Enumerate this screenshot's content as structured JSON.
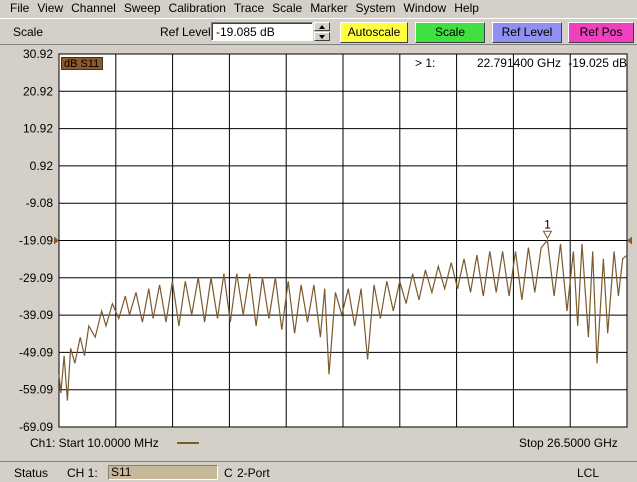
{
  "menu": [
    "File",
    "View",
    "Channel",
    "Sweep",
    "Calibration",
    "Trace",
    "Scale",
    "Marker",
    "System",
    "Window",
    "Help"
  ],
  "toolbar": {
    "scale_label": "Scale",
    "ref_level_label": "Ref Level",
    "ref_level_value": "-19.085 dB",
    "autoscale_label": "Autoscale",
    "scale_button_label": "Scale",
    "ref_level_button_label": "Ref Level",
    "ref_pos_button_label": "Ref Pos",
    "colors": {
      "autoscale": "#ffff40",
      "scale": "#40e040",
      "ref_level": "#9090f0",
      "ref_pos": "#f040c0"
    }
  },
  "plot": {
    "trace_badge": "dB S11",
    "marker": {
      "label": "> 1:",
      "freq": "22.791400 GHz",
      "value": "-19.025 dB",
      "number": "1"
    },
    "start": "Ch1: Start  10.0000 MHz",
    "stop": "Stop  26.5000 GHz",
    "trace_color": "#7b5a2e",
    "grid_color": "#000000",
    "background": "#ffffff"
  },
  "chart_data": {
    "type": "line",
    "ylabel": "dB",
    "yticks": [
      "30.92",
      "20.92",
      "10.92",
      "0.92",
      "-9.08",
      "-19.09",
      "-29.09",
      "-39.09",
      "-49.09",
      "-59.09",
      "-69.09"
    ],
    "ylim": [
      -69.09,
      30.92
    ],
    "xlim": [
      0.01,
      26.5
    ],
    "x_unit": "GHz",
    "reference_level": -19.085,
    "grid": true,
    "series": [
      {
        "values": [
          [
            0.01,
            -55
          ],
          [
            0.1,
            -60
          ],
          [
            0.25,
            -50
          ],
          [
            0.4,
            -62
          ],
          [
            0.55,
            -48
          ],
          [
            0.75,
            -52
          ],
          [
            1.0,
            -45
          ],
          [
            1.2,
            -50
          ],
          [
            1.4,
            -42
          ],
          [
            1.7,
            -45
          ],
          [
            2.0,
            -38
          ],
          [
            2.2,
            -42
          ],
          [
            2.5,
            -36
          ],
          [
            2.8,
            -40
          ],
          [
            3.1,
            -34
          ],
          [
            3.3,
            -39
          ],
          [
            3.6,
            -33
          ],
          [
            3.9,
            -41
          ],
          [
            4.2,
            -32
          ],
          [
            4.4,
            -40
          ],
          [
            4.7,
            -31
          ],
          [
            5.0,
            -41
          ],
          [
            5.3,
            -30
          ],
          [
            5.6,
            -42
          ],
          [
            5.9,
            -30
          ],
          [
            6.2,
            -39
          ],
          [
            6.5,
            -29
          ],
          [
            6.8,
            -41
          ],
          [
            7.1,
            -29
          ],
          [
            7.4,
            -40
          ],
          [
            7.7,
            -28
          ],
          [
            8.0,
            -41
          ],
          [
            8.3,
            -28
          ],
          [
            8.6,
            -39
          ],
          [
            8.9,
            -28
          ],
          [
            9.2,
            -42
          ],
          [
            9.5,
            -29
          ],
          [
            9.8,
            -40
          ],
          [
            10.1,
            -29
          ],
          [
            10.4,
            -43
          ],
          [
            10.7,
            -30
          ],
          [
            11.0,
            -44
          ],
          [
            11.3,
            -31
          ],
          [
            11.6,
            -41
          ],
          [
            11.9,
            -31
          ],
          [
            12.2,
            -45
          ],
          [
            12.4,
            -32
          ],
          [
            12.6,
            -55
          ],
          [
            12.9,
            -33
          ],
          [
            13.2,
            -39
          ],
          [
            13.5,
            -32
          ],
          [
            13.8,
            -42
          ],
          [
            14.1,
            -32
          ],
          [
            14.4,
            -51
          ],
          [
            14.7,
            -31
          ],
          [
            15.0,
            -40
          ],
          [
            15.3,
            -30
          ],
          [
            15.6,
            -38
          ],
          [
            15.9,
            -30
          ],
          [
            16.2,
            -36
          ],
          [
            16.5,
            -28
          ],
          [
            16.8,
            -35
          ],
          [
            17.1,
            -27
          ],
          [
            17.4,
            -33
          ],
          [
            17.7,
            -26
          ],
          [
            18.0,
            -32
          ],
          [
            18.3,
            -25
          ],
          [
            18.6,
            -32
          ],
          [
            18.9,
            -24
          ],
          [
            19.2,
            -33
          ],
          [
            19.5,
            -23
          ],
          [
            19.8,
            -34
          ],
          [
            20.1,
            -22
          ],
          [
            20.4,
            -33
          ],
          [
            20.7,
            -22
          ],
          [
            21.0,
            -34
          ],
          [
            21.3,
            -22
          ],
          [
            21.6,
            -35
          ],
          [
            21.9,
            -21
          ],
          [
            22.2,
            -33
          ],
          [
            22.5,
            -21
          ],
          [
            22.79,
            -19.03
          ],
          [
            23.1,
            -34
          ],
          [
            23.4,
            -20
          ],
          [
            23.7,
            -38
          ],
          [
            24.0,
            -22
          ],
          [
            24.2,
            -42
          ],
          [
            24.4,
            -20
          ],
          [
            24.7,
            -45
          ],
          [
            24.9,
            -22
          ],
          [
            25.1,
            -52
          ],
          [
            25.4,
            -24
          ],
          [
            25.6,
            -44
          ],
          [
            25.9,
            -22
          ],
          [
            26.1,
            -34
          ],
          [
            26.3,
            -24
          ],
          [
            26.5,
            -23
          ]
        ]
      }
    ]
  },
  "status": {
    "status_label": "Status",
    "channel": "CH 1:",
    "trace": "S11",
    "c": "C",
    "port": "2-Port",
    "lcl": "LCL"
  }
}
